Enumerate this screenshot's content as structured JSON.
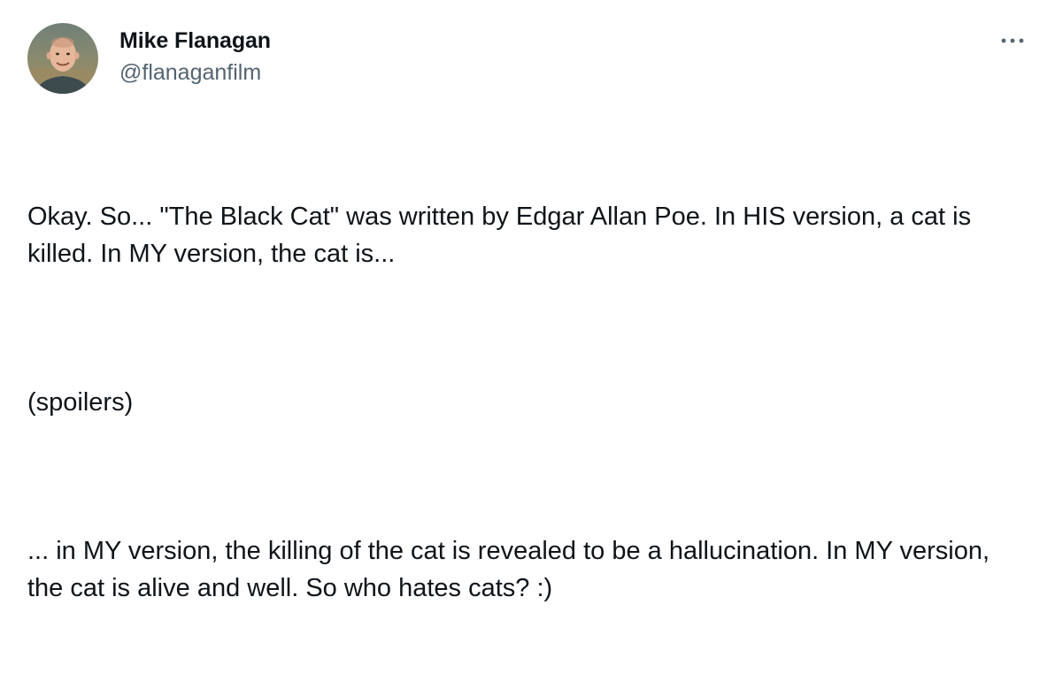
{
  "tweet": {
    "author": {
      "display_name": "Mike Flanagan",
      "handle": "@flanaganfilm",
      "avatar_icon": "profile-photo"
    },
    "more_icon": "more-horizontal-icon",
    "paragraphs": [
      "Okay. So... \"The Black Cat\" was written by Edgar Allan Poe. In HIS version, a cat is killed. In MY version, the cat is...",
      "(spoilers)",
      "... in MY version, the killing of the cat is revealed to be a hallucination. In MY version, the cat is alive and well. So who hates cats? :)"
    ]
  },
  "colors": {
    "text_primary": "#0f1419",
    "text_secondary": "#536471",
    "background": "#ffffff"
  }
}
